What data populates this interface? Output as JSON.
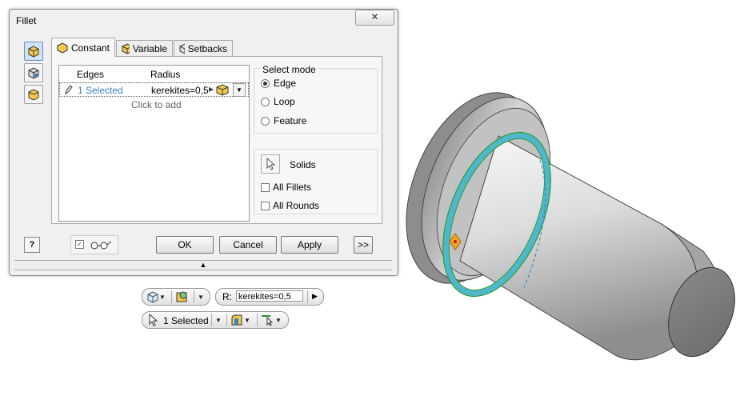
{
  "dialog": {
    "title": "Fillet",
    "close_glyph": "✕",
    "tabs": [
      {
        "label": "Constant",
        "icon": "cube-icon"
      },
      {
        "label": "Variable",
        "icon": "cube-variable-icon"
      },
      {
        "label": "Setbacks",
        "icon": "cube-setbacks-icon"
      }
    ],
    "grid": {
      "col_edges": "Edges",
      "col_radius": "Radius",
      "row": {
        "edges": "1 Selected",
        "radius": "kerekites=0,5"
      },
      "click_to_add": "Click to add"
    },
    "select_mode": {
      "title": "Select mode",
      "options": [
        "Edge",
        "Loop",
        "Feature"
      ],
      "selected": "Edge"
    },
    "solids_label": "Solids",
    "checkboxes": [
      "All Fillets",
      "All Rounds"
    ],
    "buttons": {
      "ok": "OK",
      "cancel": "Cancel",
      "apply": "Apply",
      "more": ">>"
    },
    "help": "?",
    "collapse_glyph": "▲"
  },
  "mini_toolbar": {
    "r_label": "R:",
    "r_value": "kerekites=0,5",
    "selected_label": "1 Selected"
  },
  "colors": {
    "accent": "#3a80c6",
    "fillet_highlight": "#4fb7c9"
  }
}
